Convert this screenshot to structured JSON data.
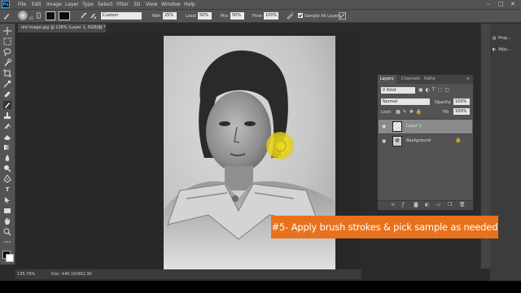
{
  "menubar": {
    "logo": "Ps",
    "items": [
      "File",
      "Edit",
      "Image",
      "Layer",
      "Type",
      "Select",
      "Filter",
      "3D",
      "View",
      "Window",
      "Help"
    ],
    "window_controls": [
      "–",
      "□",
      "✕"
    ]
  },
  "options": {
    "brush_size": "21",
    "mode_value": "Custom",
    "wet_label": "Wet:",
    "wet_value": "25%",
    "load_label": "Load:",
    "load_value": "50%",
    "mix_label": "Mix:",
    "mix_value": "50%",
    "flow_label": "Flow:",
    "flow_value": "100%",
    "sample_all_layers_label": "Sample All Layers"
  },
  "document": {
    "tab_title": "old image.jpg @ 136% (Layer 1, RGB/8) *",
    "tab_close": "×"
  },
  "tools": [
    "move-tool",
    "marquee-tool",
    "lasso-tool",
    "quick-select-tool",
    "crop-tool",
    "eyedropper-tool",
    "healing-tool",
    "brush-tool",
    "clone-stamp-tool",
    "history-brush-tool",
    "eraser-tool",
    "gradient-tool",
    "blur-tool",
    "dodge-tool",
    "pen-tool",
    "type-tool",
    "path-select-tool",
    "shape-tool",
    "hand-tool",
    "zoom-tool"
  ],
  "status": {
    "zoom": "135.76%",
    "doc_info": "Doc: 440.1K/962.3K"
  },
  "dock": {
    "items": [
      {
        "label": "Prop..."
      },
      {
        "label": "Adju..."
      }
    ]
  },
  "layers_panel": {
    "tabs": [
      "Layers",
      "Channels",
      "Paths"
    ],
    "kind_filter": "Kind",
    "blend_mode": "Normal",
    "opacity_label": "Opacity:",
    "opacity_value": "100%",
    "lock_label": "Lock:",
    "fill_label": "Fill:",
    "fill_value": "100%",
    "layers": [
      {
        "name": "Layer 1",
        "selected": true
      },
      {
        "name": "Background",
        "selected": false
      }
    ]
  },
  "caption": {
    "text": "#5- Apply brush strokes & pick sample as needed",
    "color": "#e8721c"
  }
}
